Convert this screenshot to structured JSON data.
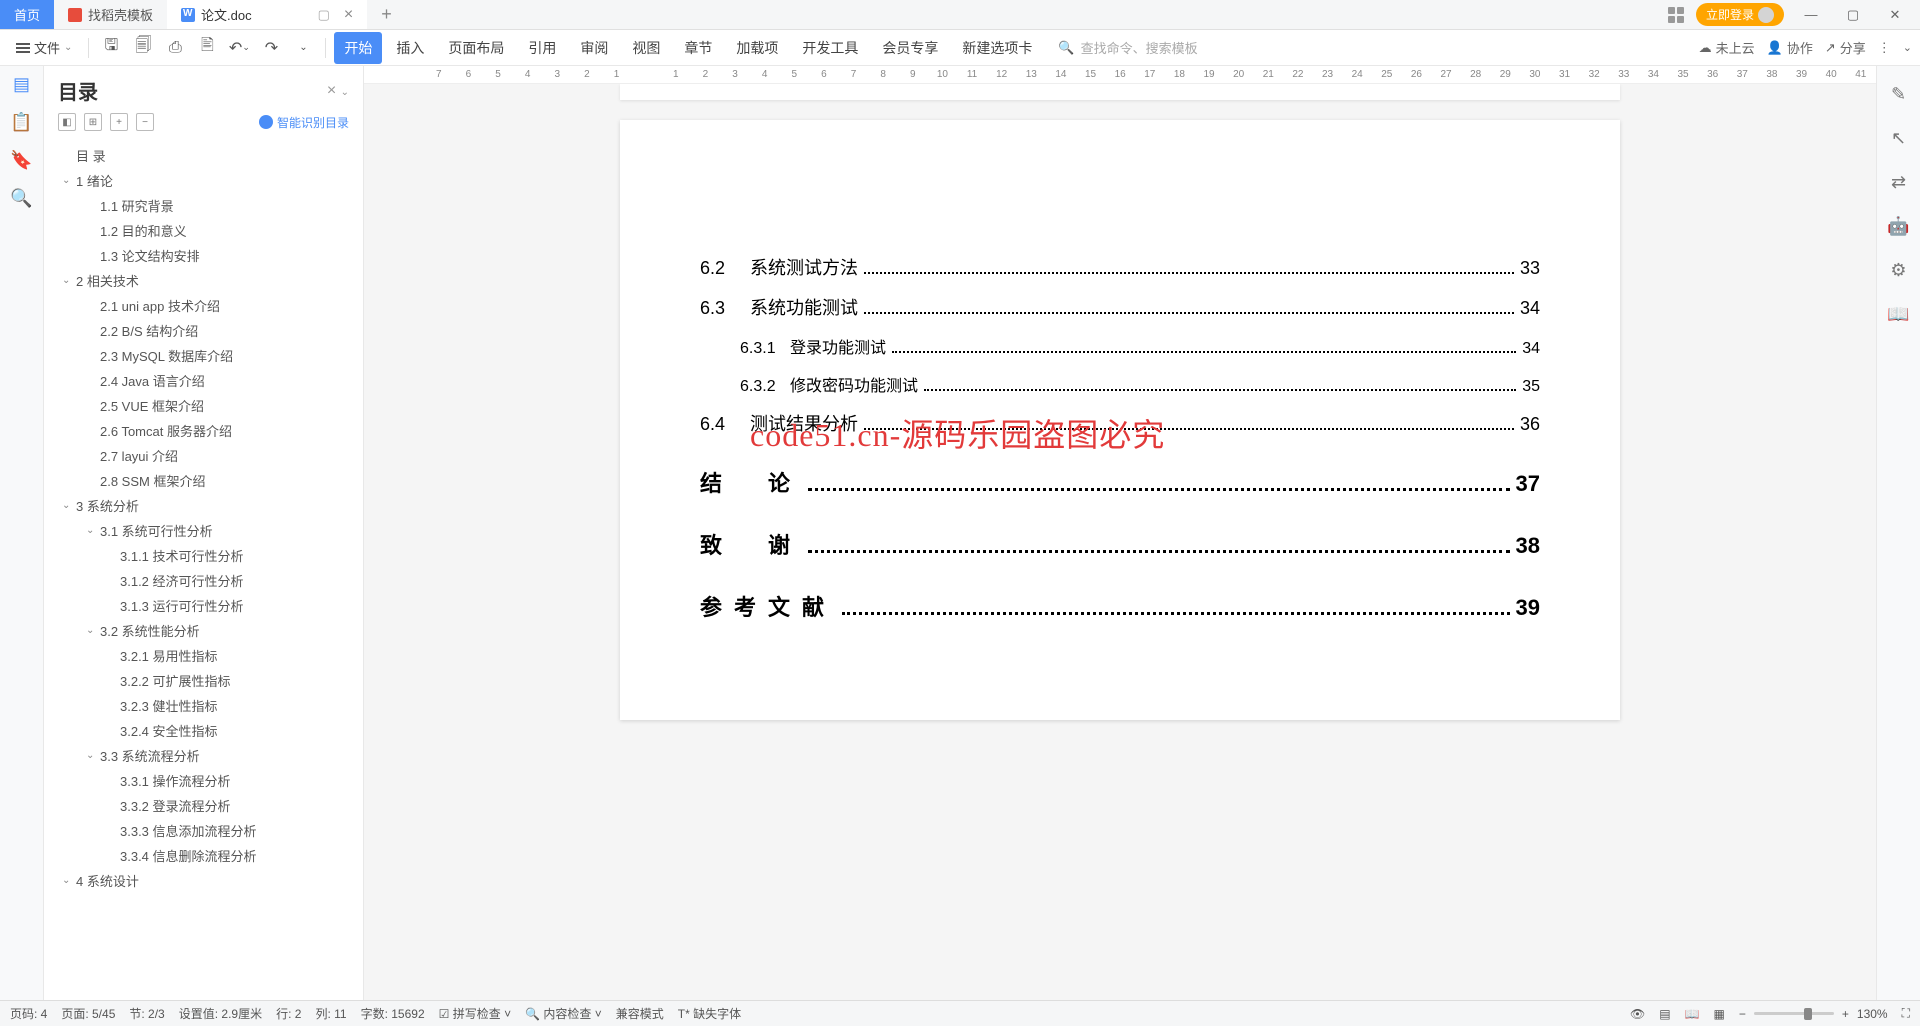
{
  "titlebar": {
    "home": "首页",
    "tab1": "找稻壳模板",
    "tab2": "论文.doc",
    "login": "立即登录"
  },
  "toolbar": {
    "file": "文件",
    "menus": [
      "开始",
      "插入",
      "页面布局",
      "引用",
      "审阅",
      "视图",
      "章节",
      "加载项",
      "开发工具",
      "会员专享",
      "新建选项卡"
    ],
    "search_placeholder": "查找命令、搜索模板",
    "cloud": "未上云",
    "collab": "协作",
    "share": "分享"
  },
  "outline": {
    "title": "目录",
    "smart": "智能识别目录",
    "items": [
      {
        "lv": 0,
        "chev": "",
        "text": "目 录"
      },
      {
        "lv": 1,
        "chev": "⌄",
        "text": "1 绪论"
      },
      {
        "lv": 2,
        "chev": "",
        "text": "1.1 研究背景"
      },
      {
        "lv": 2,
        "chev": "",
        "text": "1.2 目的和意义"
      },
      {
        "lv": 2,
        "chev": "",
        "text": "1.3 论文结构安排"
      },
      {
        "lv": 1,
        "chev": "⌄",
        "text": "2 相关技术"
      },
      {
        "lv": 2,
        "chev": "",
        "text": "2.1 uni app 技术介绍"
      },
      {
        "lv": 2,
        "chev": "",
        "text": "2.2 B/S 结构介绍"
      },
      {
        "lv": 2,
        "chev": "",
        "text": "2.3 MySQL 数据库介绍"
      },
      {
        "lv": 2,
        "chev": "",
        "text": "2.4 Java 语言介绍"
      },
      {
        "lv": 2,
        "chev": "",
        "text": "2.5 VUE 框架介绍"
      },
      {
        "lv": 2,
        "chev": "",
        "text": "2.6 Tomcat 服务器介绍"
      },
      {
        "lv": 2,
        "chev": "",
        "text": "2.7 layui 介绍"
      },
      {
        "lv": 2,
        "chev": "",
        "text": "2.8 SSM 框架介绍"
      },
      {
        "lv": 1,
        "chev": "⌄",
        "text": "3 系统分析"
      },
      {
        "lv": 3,
        "chev": "⌄",
        "text": "3.1 系统可行性分析"
      },
      {
        "lv": 4,
        "chev": "",
        "text": "3.1.1 技术可行性分析"
      },
      {
        "lv": 4,
        "chev": "",
        "text": "3.1.2 经济可行性分析"
      },
      {
        "lv": 4,
        "chev": "",
        "text": "3.1.3 运行可行性分析"
      },
      {
        "lv": 3,
        "chev": "⌄",
        "text": "3.2 系统性能分析"
      },
      {
        "lv": 4,
        "chev": "",
        "text": "3.2.1 易用性指标"
      },
      {
        "lv": 4,
        "chev": "",
        "text": "3.2.2 可扩展性指标"
      },
      {
        "lv": 4,
        "chev": "",
        "text": "3.2.3 健壮性指标"
      },
      {
        "lv": 4,
        "chev": "",
        "text": "3.2.4 安全性指标"
      },
      {
        "lv": 3,
        "chev": "⌄",
        "text": "3.3 系统流程分析"
      },
      {
        "lv": 4,
        "chev": "",
        "text": "3.3.1 操作流程分析"
      },
      {
        "lv": 4,
        "chev": "",
        "text": "3.3.2 登录流程分析"
      },
      {
        "lv": 4,
        "chev": "",
        "text": "3.3.3 信息添加流程分析"
      },
      {
        "lv": 4,
        "chev": "",
        "text": "3.3.4 信息删除流程分析"
      },
      {
        "lv": 1,
        "chev": "⌄",
        "text": "4 系统设计"
      }
    ]
  },
  "ruler": [
    "7",
    "6",
    "5",
    "4",
    "3",
    "2",
    "1",
    "",
    "1",
    "2",
    "3",
    "4",
    "5",
    "6",
    "7",
    "8",
    "9",
    "10",
    "11",
    "12",
    "13",
    "14",
    "15",
    "16",
    "17",
    "18",
    "19",
    "20",
    "21",
    "22",
    "23",
    "24",
    "25",
    "26",
    "27",
    "28",
    "29",
    "30",
    "31",
    "32",
    "33",
    "34",
    "35",
    "36",
    "37",
    "38",
    "39",
    "40",
    "41"
  ],
  "toc": [
    {
      "cls": "",
      "num": "6.2",
      "text": "系统测试方法",
      "page": "33"
    },
    {
      "cls": "",
      "num": "6.3",
      "text": "系统功能测试",
      "page": "34"
    },
    {
      "cls": "h3",
      "num": "6.3.1",
      "text": "登录功能测试",
      "page": "34"
    },
    {
      "cls": "h3",
      "num": "6.3.2",
      "text": "修改密码功能测试",
      "page": "35"
    },
    {
      "cls": "",
      "num": "6.4",
      "text": "测试结果分析",
      "page": "36"
    },
    {
      "cls": "h1",
      "num": "",
      "text": "结　论",
      "page": "37"
    },
    {
      "cls": "h1",
      "num": "",
      "text": "致　谢",
      "page": "38"
    },
    {
      "cls": "h1",
      "num": "",
      "text": "参考文献",
      "page": "39"
    }
  ],
  "watermark": "code51.cn-源码乐园盗图必究",
  "status": {
    "page_no": "页码: 4",
    "page": "页面: 5/45",
    "section": "节: 2/3",
    "setval": "设置值: 2.9厘米",
    "row": "行: 2",
    "col": "列: 11",
    "words": "字数: 15692",
    "spell": "拼写检查",
    "content": "内容检查",
    "compat": "兼容模式",
    "font": "缺失字体",
    "zoom": "130%"
  }
}
